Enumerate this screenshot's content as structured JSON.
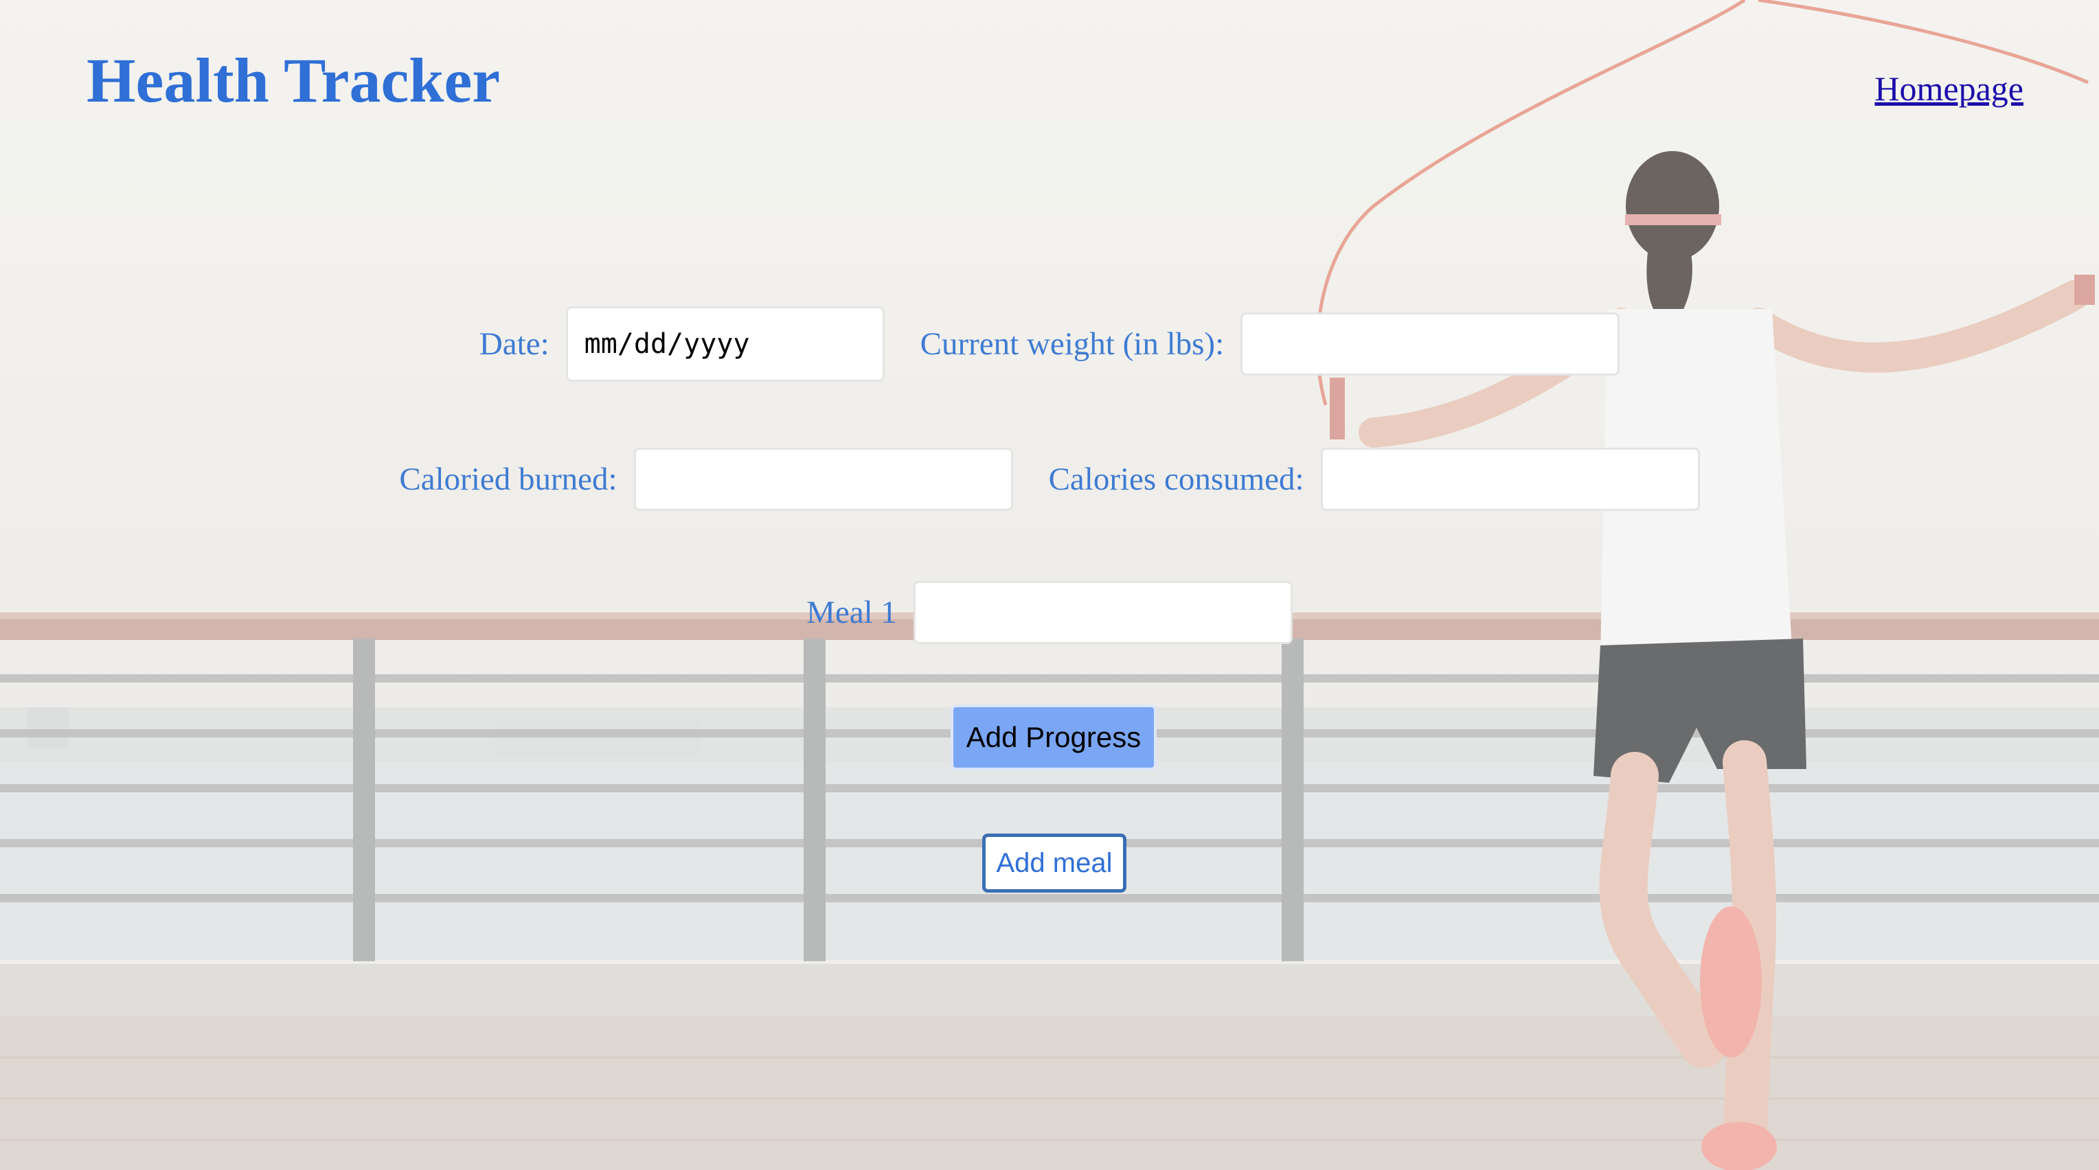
{
  "header": {
    "title": "Health Tracker",
    "homepage_link": "Homepage"
  },
  "form": {
    "date_label": "Date:",
    "date_placeholder": "mm/dd/yyyy",
    "weight_label": "Current weight (in lbs):",
    "weight_value": "",
    "burned_label": "Caloried burned:",
    "burned_value": "",
    "consumed_label": "Calories consumed:",
    "consumed_value": "",
    "meal_label": "Meal 1",
    "meal_value": "",
    "add_progress_label": "Add Progress",
    "add_meal_label": "Add meal"
  },
  "colors": {
    "title": "#2f6fd6",
    "label": "#3e7bd3",
    "primary_button": "#7ba6f5",
    "link": "#1a0dab"
  },
  "background": {
    "icon": "woman-jumping-rope-waterfront-photo"
  }
}
